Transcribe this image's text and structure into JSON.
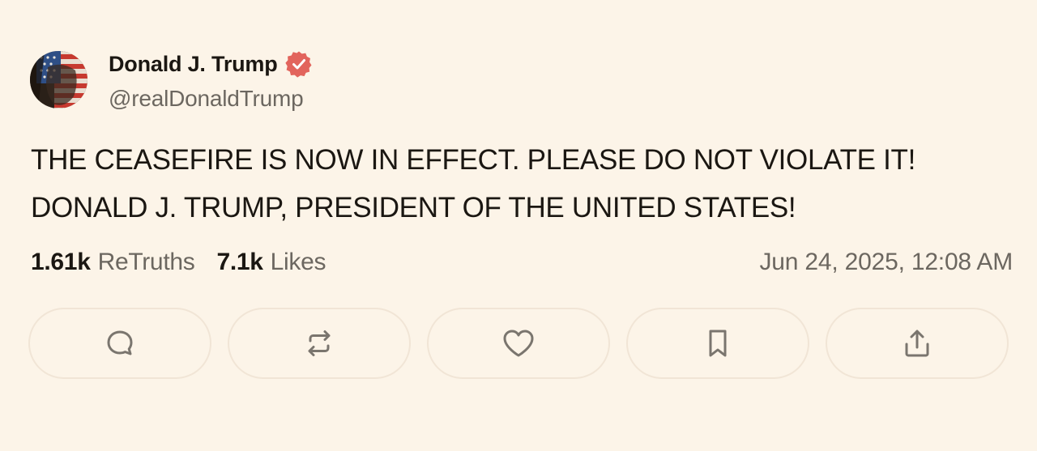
{
  "author": {
    "display_name": "Donald J. Trump",
    "handle": "@realDonaldTrump",
    "verified_icon": "verified-badge-icon",
    "avatar": "avatar-flag-portrait"
  },
  "post": {
    "lines": [
      "THE CEASEFIRE IS NOW IN EFFECT. PLEASE DO NOT VIOLATE IT!",
      "DONALD J. TRUMP, PRESIDENT OF THE UNITED STATES!"
    ]
  },
  "stats": {
    "retruths_count": "1.61k",
    "retruths_label": "ReTruths",
    "likes_count": "7.1k",
    "likes_label": "Likes",
    "timestamp": "Jun 24, 2025, 12:08 AM"
  },
  "actions": [
    {
      "name": "reply",
      "icon": "reply-icon"
    },
    {
      "name": "retruth",
      "icon": "retruth-icon"
    },
    {
      "name": "like",
      "icon": "heart-icon"
    },
    {
      "name": "bookmark",
      "icon": "bookmark-icon"
    },
    {
      "name": "share",
      "icon": "share-icon"
    }
  ],
  "colors": {
    "background": "#fcf4e8",
    "text": "#1b1712",
    "muted": "#6c6760",
    "verified_badge": "#e2645c",
    "button_border": "#f1e5d6",
    "icon_stroke": "#7a756e"
  }
}
